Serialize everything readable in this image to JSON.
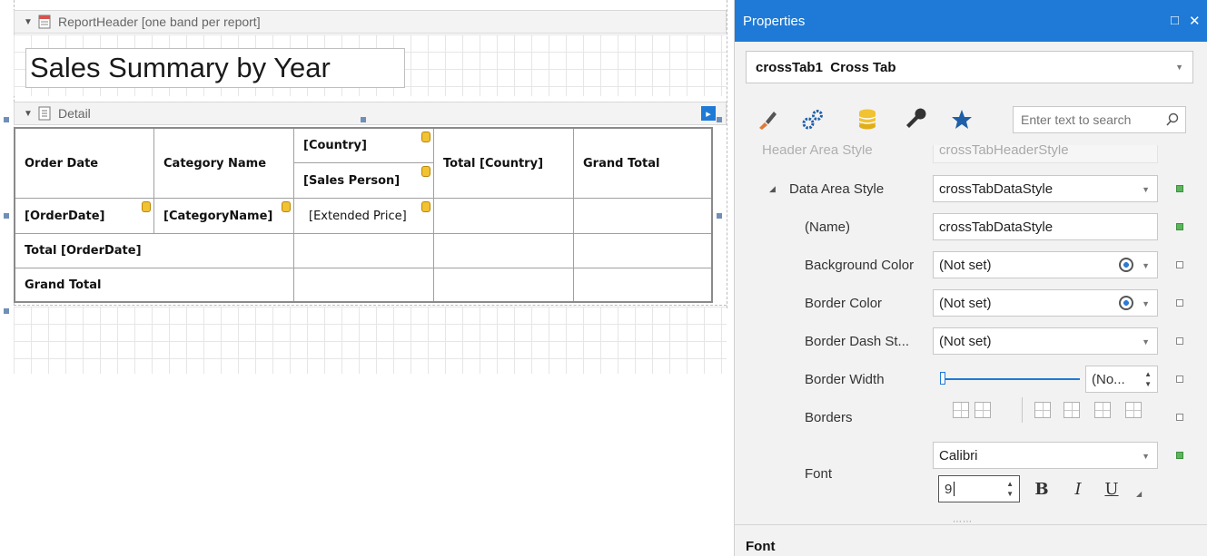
{
  "designer": {
    "report_header_band": "ReportHeader [one band per report]",
    "detail_band": "Detail",
    "report_title": "Sales Summary by Year",
    "crosstab": {
      "header_order_date": "Order Date",
      "header_category_name": "Category Name",
      "header_country": "[Country]",
      "header_sales_person": "[Sales Person]",
      "header_total_country": "Total [Country]",
      "header_grand_total": "Grand Total",
      "row_order_date": "[OrderDate]",
      "row_category_name": "[CategoryName]",
      "row_extended_price": "[Extended Price]",
      "row_total_order_date": "Total [OrderDate]",
      "row_grand_total": "Grand Total"
    }
  },
  "properties": {
    "title": "Properties",
    "maximize_glyph": "□",
    "close_glyph": "✕",
    "selected_object_name": "crossTab1",
    "selected_object_type": "Cross Tab",
    "search_placeholder": "Enter text to search",
    "partial_row": {
      "label": "Header Area Style",
      "value": "crossTabHeaderStyle"
    },
    "rows": [
      {
        "label": "Data Area Style",
        "value": "crossTabDataStyle",
        "expander": "◢",
        "set": true
      },
      {
        "label": "(Name)",
        "value": "crossTabDataStyle",
        "set": true
      },
      {
        "label": "Background Color",
        "value": "(Not set)",
        "set": false
      },
      {
        "label": "Border Color",
        "value": "(Not set)",
        "set": false
      },
      {
        "label": "Border Dash St...",
        "value": "(Not set)",
        "set": false
      },
      {
        "label": "Border Width",
        "value": "(No...",
        "set": false
      },
      {
        "label": "Borders",
        "value": "",
        "set": false
      },
      {
        "label": "Font",
        "value": "Calibri",
        "set": true
      }
    ],
    "font_size": "9",
    "bold_label": "B",
    "italic_label": "I",
    "underline_label": "U",
    "section_heading": "Font"
  },
  "colors": {
    "accent": "#1e7ad6",
    "set_marker": "#5bb55b"
  }
}
